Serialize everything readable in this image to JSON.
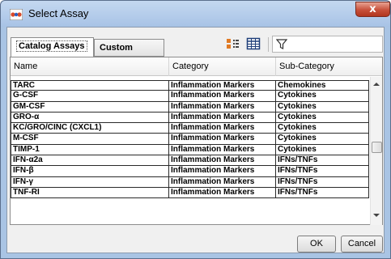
{
  "window": {
    "title": "Select Assay",
    "close_label": "x"
  },
  "tabs": [
    {
      "label": "Catalog Assays",
      "active": true
    },
    {
      "label": "Custom Assays",
      "active": false
    }
  ],
  "filter": {
    "value": "",
    "icon": "filter-funnel-icon"
  },
  "table": {
    "columns": [
      "Name",
      "Category",
      "Sub-Category"
    ],
    "rows": [
      [
        "TARC",
        "Inflammation Markers",
        "Chemokines"
      ],
      [
        "G-CSF",
        "Inflammation Markers",
        "Cytokines"
      ],
      [
        "GM-CSF",
        "Inflammation Markers",
        "Cytokines"
      ],
      [
        "GRO-α",
        "Inflammation Markers",
        "Cytokines"
      ],
      [
        "KC/GRO/CINC (CXCL1)",
        "Inflammation Markers",
        "Cytokines"
      ],
      [
        "M-CSF",
        "Inflammation Markers",
        "Cytokines"
      ],
      [
        "TIMP-1",
        "Inflammation Markers",
        "Cytokines"
      ],
      [
        "IFN-α2a",
        "Inflammation Markers",
        "IFNs/TNFs"
      ],
      [
        "IFN-β",
        "Inflammation Markers",
        "IFNs/TNFs"
      ],
      [
        "IFN-γ",
        "Inflammation Markers",
        "IFNs/TNFs"
      ],
      [
        "TNF-RI",
        "Inflammation Markers",
        "IFNs/TNFs"
      ]
    ]
  },
  "buttons": {
    "ok": "OK",
    "cancel": "Cancel"
  },
  "colors": {
    "title_bar": "#a8c3e6",
    "close_button": "#c7503a",
    "dialog_bg": "#f0f0f0"
  }
}
